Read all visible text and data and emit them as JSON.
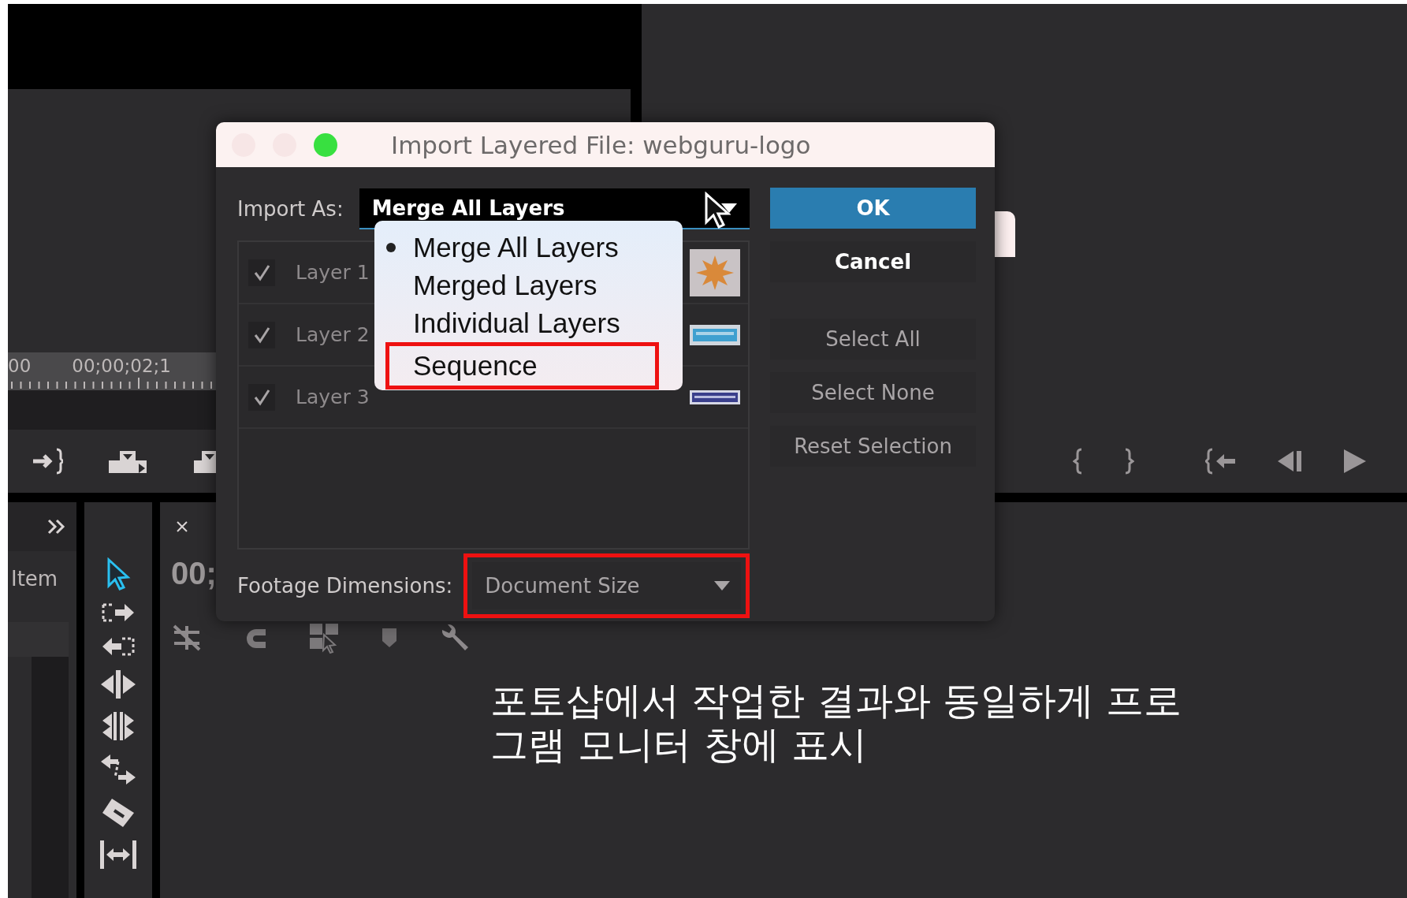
{
  "source_monitor": {
    "ruler_start": "00",
    "ruler_time": "00;00;02;1"
  },
  "project_panel": {
    "column_label": "Item"
  },
  "timeline": {
    "timecode": "00;"
  },
  "dialog": {
    "title": "Import Layered File: webguru-logo",
    "import_as": {
      "label": "Import As:",
      "value": "Merge All Layers"
    },
    "menu": [
      {
        "label": "Merge All Layers",
        "selected": true,
        "annotated": false
      },
      {
        "label": "Merged Layers",
        "selected": false,
        "annotated": false
      },
      {
        "label": "Individual Layers",
        "selected": false,
        "annotated": false
      },
      {
        "label": "Sequence",
        "selected": false,
        "annotated": true
      }
    ],
    "layers": [
      {
        "label": "Layer 1",
        "checked": true,
        "kind": "picture"
      },
      {
        "label": "Layer 2",
        "checked": true,
        "kind": "picture"
      },
      {
        "label": "Layer 3",
        "checked": true,
        "kind": "picture"
      }
    ],
    "buttons": [
      {
        "label": "OK",
        "kind": "primary"
      },
      {
        "label": "Cancel",
        "kind": "default"
      },
      {
        "label": "Select All",
        "kind": "secondary"
      },
      {
        "label": "Select None",
        "kind": "secondary"
      },
      {
        "label": "Reset Selection",
        "kind": "secondary"
      }
    ],
    "footage": {
      "label": "Footage Dimensions:",
      "value": "Document Size",
      "annotated": true
    }
  },
  "caption": "포토샵에서 작업한 결과와 동일하게 프로\n그램 모니터 창에 표시"
}
